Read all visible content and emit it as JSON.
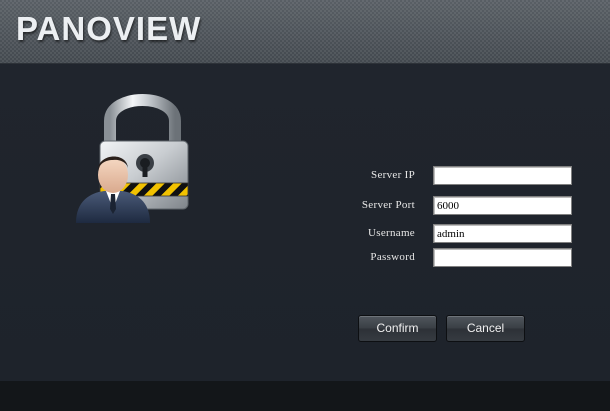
{
  "header": {
    "brand": "PANOVIEW"
  },
  "form": {
    "server_ip": {
      "label": "Server IP",
      "value": ""
    },
    "server_port": {
      "label": "Server Port",
      "value": "6000"
    },
    "username": {
      "label": "Username",
      "value": "admin"
    },
    "password": {
      "label": "Password",
      "value": ""
    }
  },
  "buttons": {
    "confirm": "Confirm",
    "cancel": "Cancel"
  },
  "icons": {
    "illustration": "padlock-user-icon"
  },
  "colors": {
    "background": "#1f242c",
    "header": "#4c5258",
    "footer": "#131619",
    "label_text": "#e8e8e8"
  }
}
